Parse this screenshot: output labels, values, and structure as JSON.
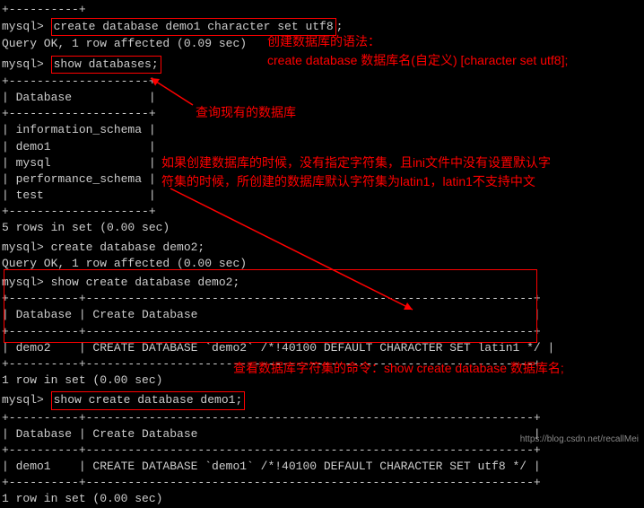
{
  "prompt": "mysql> ",
  "cmd1": "create database demo1 character set utf8",
  "semicolon": ";",
  "result1": "Query OK, 1 row affected (0.09 sec)",
  "cmd2": "show databases;",
  "tb_sep_single": "+--------------------+",
  "tb_hdr_db": "| Database           |",
  "db_list": {
    "r1": "| information_schema |",
    "r2": "| demo1              |",
    "r3": "| mysql              |",
    "r4": "| performance_schema |",
    "r5": "| test               |"
  },
  "rows5": "5 rows in set (0.00 sec)",
  "cmd3": "create database demo2;",
  "result3": "Query OK, 1 row affected (0.00 sec)",
  "cmd4": "show create database demo2;",
  "sep_wide": "+----------+----------------------------------------------------------------+",
  "hdr_wide": "| Database | Create Database                                                |",
  "row_demo2": "| demo2    | CREATE DATABASE `demo2` /*!40100 DEFAULT CHARACTER SET latin1 */ |",
  "row1": "1 row in set (0.00 sec)",
  "cmd5": "show create database demo1;",
  "sep_wide2": "+----------+----------------------------------------------------------------+",
  "hdr_wide2": "| Database | Create Database                                                |",
  "row_demo1": "| demo1    | CREATE DATABASE `demo1` /*!40100 DEFAULT CHARACTER SET utf8 */ |",
  "notes": {
    "n1a": "创建数据库的语法：",
    "n1b": "create database 数据库名(自定义) [character set utf8];",
    "n2": "查询现有的数据库",
    "n3a": "如果创建数据库的时候，没有指定字符集，且ini文件中没有设置默认字",
    "n3b": "符集的时候，所创建的数据库默认字符集为latin1，latin1不支持中文",
    "n4": "查看数据库字符集的命令：show create database 数据库名;"
  },
  "watermark": "https://blog.csdn.net/recallMei"
}
